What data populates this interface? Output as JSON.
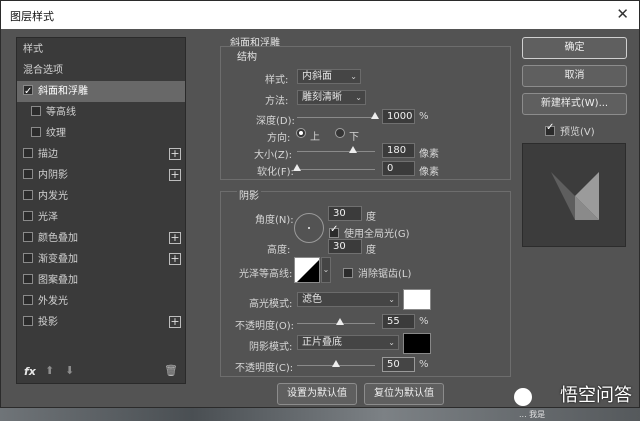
{
  "dialog": {
    "title": "图层样式",
    "close_glyph": "✕"
  },
  "left_panel": {
    "styles_header": "样式",
    "blending_options": "混合选项",
    "items": [
      {
        "label": "斜面和浮雕",
        "checked": true,
        "has_plus": false
      },
      {
        "label": "等高线",
        "checked": false,
        "has_plus": false
      },
      {
        "label": "纹理",
        "checked": false,
        "has_plus": false
      },
      {
        "label": "描边",
        "checked": false,
        "has_plus": true
      },
      {
        "label": "内阴影",
        "checked": false,
        "has_plus": true
      },
      {
        "label": "内发光",
        "checked": false,
        "has_plus": false
      },
      {
        "label": "光泽",
        "checked": false,
        "has_plus": false
      },
      {
        "label": "颜色叠加",
        "checked": false,
        "has_plus": true
      },
      {
        "label": "渐变叠加",
        "checked": false,
        "has_plus": true
      },
      {
        "label": "图案叠加",
        "checked": false,
        "has_plus": false
      },
      {
        "label": "外发光",
        "checked": false,
        "has_plus": false
      },
      {
        "label": "投影",
        "checked": false,
        "has_plus": true
      }
    ],
    "footer": {
      "fx": "fx",
      "up": "⬆",
      "down": "⬇",
      "trash": "🗑"
    }
  },
  "bevel": {
    "title": "斜面和浮雕",
    "structure": {
      "title": "结构",
      "style_label": "样式:",
      "style_value": "内斜面",
      "technique_label": "方法:",
      "technique_value": "雕刻清晰",
      "depth_label": "深度(D):",
      "depth_value": "1000",
      "depth_unit": "%",
      "depth_level": 1.0,
      "direction_label": "方向:",
      "dir_up": "上",
      "dir_down": "下",
      "size_label": "大小(Z):",
      "size_value": "180",
      "size_unit": "像素",
      "size_level": 0.72,
      "soften_label": "软化(F):",
      "soften_value": "0",
      "soften_unit": "像素",
      "soften_level": 0.0
    },
    "shading": {
      "title": "阴影",
      "angle_label": "角度(N):",
      "angle_value": "30",
      "angle_unit": "度",
      "global_light": "使用全局光(G)",
      "altitude_label": "高度:",
      "altitude_value": "30",
      "altitude_unit": "度",
      "gloss_label": "光泽等高线:",
      "anti_alias": "消除锯齿(L)",
      "highlight_label": "高光模式:",
      "highlight_mode": "滤色",
      "highlight_color": "#ffffff",
      "opacity_label": "不透明度(O):",
      "opacity_value": "55",
      "opacity_unit": "%",
      "opacity_level": 0.55,
      "shadow_label": "阴影模式:",
      "shadow_mode": "正片叠底",
      "shadow_color": "#000000",
      "shadow_opacity_label": "不透明度(C):",
      "shadow_opacity_value": "50",
      "shadow_opacity_unit": "%",
      "shadow_opacity_level": 0.5
    },
    "make_default": "设置为默认值",
    "reset_default": "复位为默认值"
  },
  "right": {
    "ok": "确定",
    "cancel": "取消",
    "new_style": "新建样式(W)...",
    "preview_label": "预览(V)"
  },
  "watermark": {
    "text": "悟空问答",
    "sub": "...  我是"
  }
}
